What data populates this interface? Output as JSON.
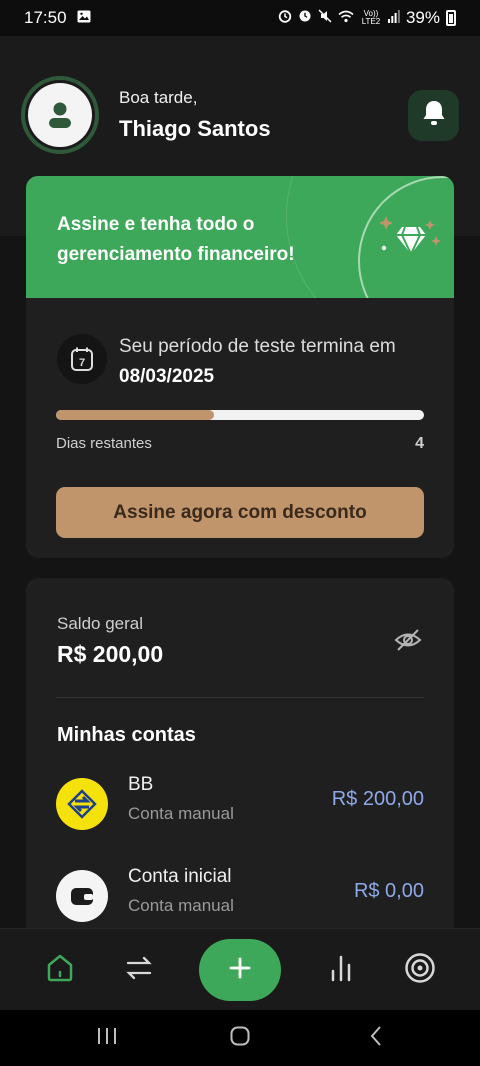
{
  "status_bar": {
    "time": "17:50",
    "network_label": "Vo)) LTE2",
    "battery": "39%"
  },
  "header": {
    "greeting": "Boa tarde,",
    "user_name": "Thiago Santos"
  },
  "promo": {
    "title": "Assine e tenha todo o gerenciamento financeiro!",
    "trial_text": "Seu período de teste termina em",
    "trial_end_date": "08/03/2025",
    "calendar_day": "7",
    "days_label": "Dias restantes",
    "days_remaining": "4",
    "progress_fraction": 0.43,
    "cta_label": "Assine agora com desconto"
  },
  "balance": {
    "label": "Saldo geral",
    "value": "R$ 200,00"
  },
  "accounts": {
    "title": "Minhas contas",
    "items": [
      {
        "name": "BB",
        "type": "Conta manual",
        "amount": "R$ 200,00",
        "icon": "banco-do-brasil-logo"
      },
      {
        "name": "Conta inicial",
        "type": "Conta manual",
        "amount": "R$ 0,00",
        "icon": "wallet-icon"
      }
    ]
  },
  "nav": {
    "items": [
      "home-icon",
      "transfer-icon",
      "add-icon",
      "chart-icon",
      "target-icon"
    ]
  },
  "colors": {
    "accent_green": "#3ea85a",
    "accent_tan": "#c0956c",
    "amount_blue": "#8fa8e8",
    "card_bg": "#1f1f1f"
  }
}
